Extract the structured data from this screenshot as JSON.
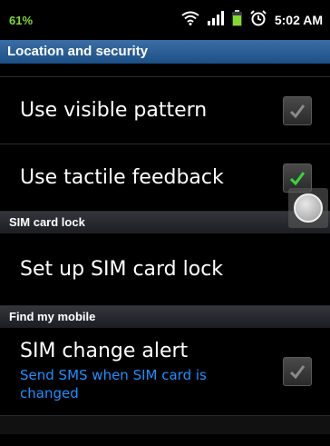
{
  "status_bar": {
    "left_text": "61%",
    "time": "5:02 AM",
    "icons": [
      "wifi-icon",
      "signal-icon",
      "battery-icon",
      "alarm-icon"
    ],
    "left_text_color": "#7fdc2c"
  },
  "title_bar": {
    "title": "Location and security"
  },
  "settings": {
    "visible_pattern": {
      "label": "Use visible pattern",
      "checked": false
    },
    "tactile_feedback": {
      "label": "Use tactile feedback",
      "checked": true
    },
    "sim_lock_header": "SIM card lock",
    "setup_sim_lock": {
      "label": "Set up SIM card lock"
    },
    "find_mobile_header": "Find my mobile",
    "sim_change_alert": {
      "label": "SIM change alert",
      "summary": "Send SMS when SIM card is changed",
      "checked": false
    }
  },
  "colors": {
    "title_bar": "#1c4f86",
    "summary_text": "#1e90ff",
    "check_on": "#36d63a",
    "check_off": "#8a8a8a"
  }
}
